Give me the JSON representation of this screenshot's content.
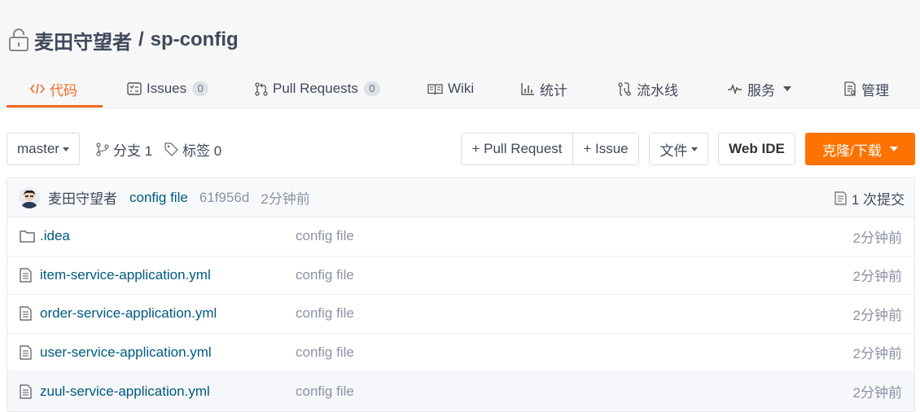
{
  "repo": {
    "owner": "麦田守望者",
    "separator": "/",
    "name": "sp-config"
  },
  "tabs": [
    {
      "label": "代码",
      "icon": "code-icon",
      "active": true
    },
    {
      "label": "Issues",
      "icon": "issues-icon",
      "count": "0"
    },
    {
      "label": "Pull Requests",
      "icon": "pull-request-icon",
      "count": "0"
    },
    {
      "label": "Wiki",
      "icon": "book-icon"
    },
    {
      "label": "统计",
      "icon": "bar-chart-icon"
    },
    {
      "label": "流水线",
      "icon": "pipeline-icon"
    },
    {
      "label": "服务",
      "icon": "pulse-icon",
      "dropdown": true
    },
    {
      "label": "管理",
      "icon": "settings-doc-icon"
    }
  ],
  "toolbar": {
    "branch": "master",
    "branches_label": "分支 1",
    "tags_label": "标签 0",
    "new_pr": "+ Pull Request",
    "new_issue": "+ Issue",
    "file_menu": "文件",
    "web_ide": "Web IDE",
    "clone": "克隆/下载"
  },
  "commit": {
    "author": "麦田守望者",
    "message": "config file",
    "sha": "61f956d",
    "time": "2分钟前",
    "count_label": "1 次提交"
  },
  "files": [
    {
      "name": ".idea",
      "type": "folder",
      "message": "config file",
      "time": "2分钟前"
    },
    {
      "name": "item-service-application.yml",
      "type": "file",
      "message": "config file",
      "time": "2分钟前"
    },
    {
      "name": "order-service-application.yml",
      "type": "file",
      "message": "config file",
      "time": "2分钟前"
    },
    {
      "name": "user-service-application.yml",
      "type": "file",
      "message": "config file",
      "time": "2分钟前"
    },
    {
      "name": "zuul-service-application.yml",
      "type": "file",
      "message": "config file",
      "time": "2分钟前"
    }
  ],
  "colors": {
    "accent": "#f26b25",
    "clone_button": "#fe7300",
    "link": "#005980",
    "muted": "#8c92a4"
  }
}
